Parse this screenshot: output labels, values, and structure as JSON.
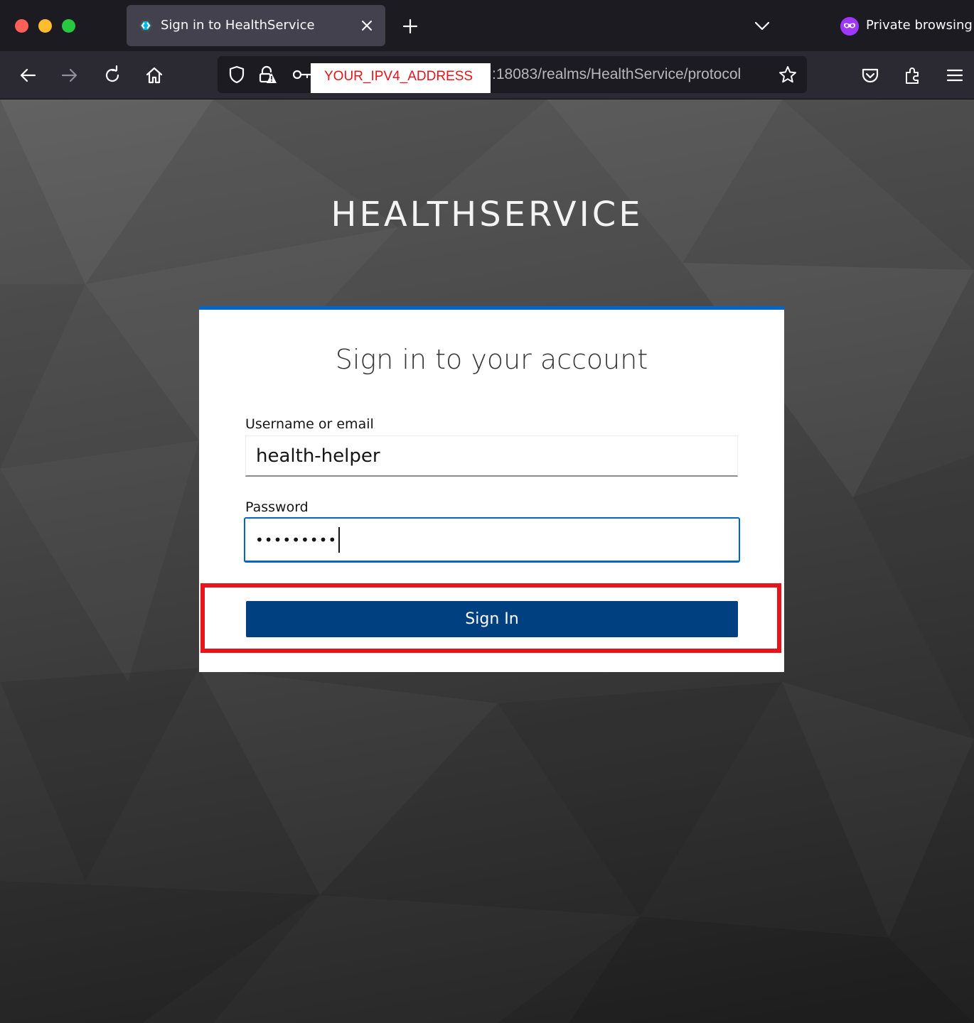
{
  "browser": {
    "tab_title": "Sign in to HealthService",
    "private_label": "Private browsing",
    "url_redacted": "YOUR_IPV4_ADDRESS",
    "url_rest": ":18083/realms/HealthService/protocol"
  },
  "page": {
    "brand": "HEALTHSERVICE",
    "title": "Sign in to your account",
    "username_label": "Username or email",
    "username_value": "health-helper",
    "password_label": "Password",
    "password_value": "•••••••••",
    "signin_label": "Sign In"
  },
  "colors": {
    "accent": "#0066cc",
    "button": "#004080",
    "highlight": "#e8141c"
  }
}
